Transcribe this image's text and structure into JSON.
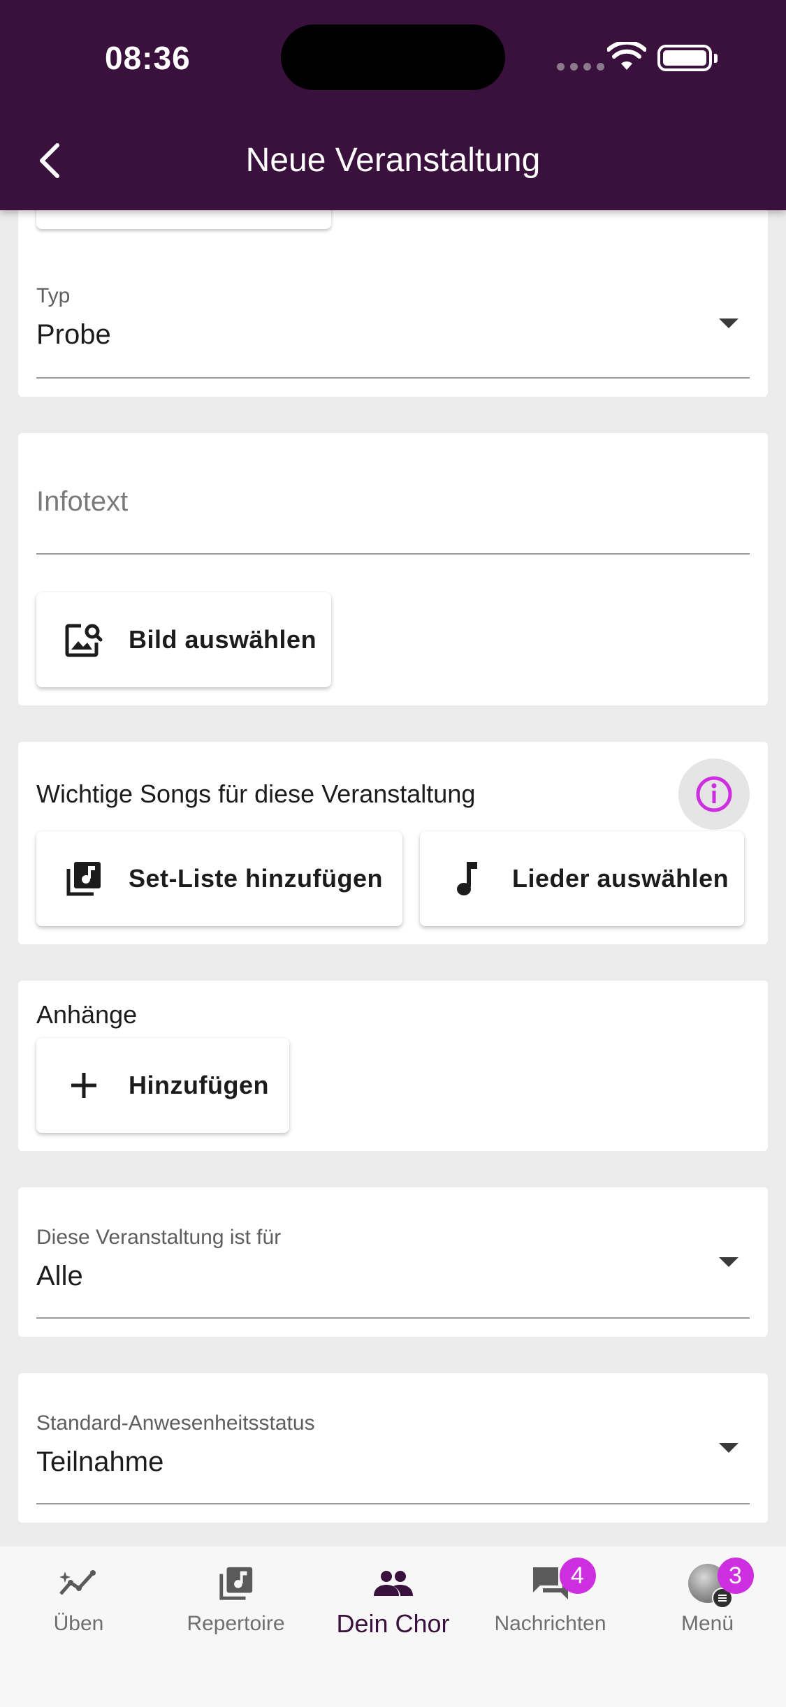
{
  "status_bar": {
    "time": "08:36"
  },
  "header": {
    "title": "Neue Veranstaltung"
  },
  "type_field": {
    "label": "Typ",
    "value": "Probe"
  },
  "info_field": {
    "placeholder": "Infotext"
  },
  "image_button": {
    "label": "Bild auswählen"
  },
  "songs_section": {
    "title": "Wichtige Songs für diese Veranstaltung",
    "setlist_button": "Set-Liste hinzufügen",
    "songs_button": "Lieder auswählen"
  },
  "attachments": {
    "title": "Anhänge",
    "add_button": "Hinzufügen"
  },
  "audience_field": {
    "label": "Diese Veranstaltung ist für",
    "value": "Alle"
  },
  "attendance_field": {
    "label": "Standard-Anwesenheitsstatus",
    "value": "Teilnahme"
  },
  "bottom_nav": {
    "items": [
      {
        "label": "Üben",
        "icon": "trend-icon"
      },
      {
        "label": "Repertoire",
        "icon": "music-library-icon"
      },
      {
        "label": "Dein Chor",
        "icon": "group-icon"
      },
      {
        "label": "Nachrichten",
        "icon": "chat-icon",
        "badge": "4"
      },
      {
        "label": "Menü",
        "icon": "avatar-icon",
        "badge": "3"
      }
    ],
    "active_index": 2
  },
  "colors": {
    "header": "#3a103d",
    "accent": "#cc2ee0",
    "background": "#ececec"
  }
}
